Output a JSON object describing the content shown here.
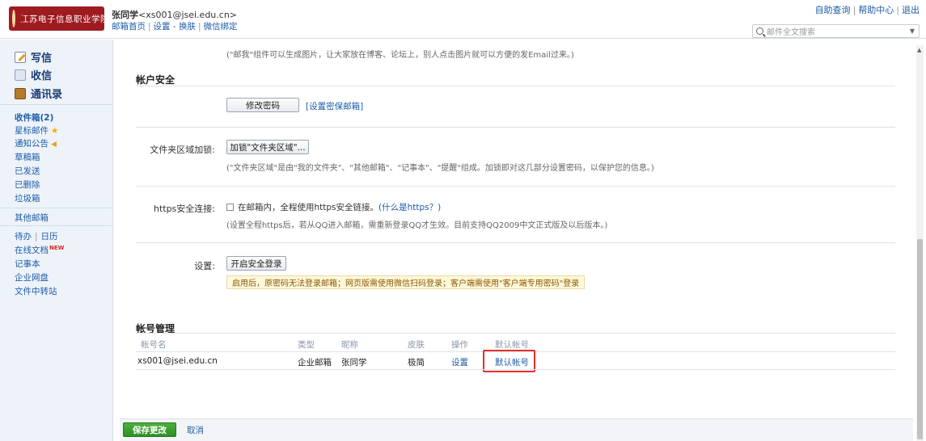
{
  "header": {
    "logo_text": "江苏电子信息职业学院",
    "user_name": "张同学",
    "user_email": "<xs001@jsei.edu.cn>",
    "links": [
      "邮箱首页",
      "设置",
      "换肤",
      "微信绑定"
    ],
    "top_links": [
      "自助查询",
      "帮助中心",
      "退出"
    ],
    "search_placeholder": "邮件全文搜索"
  },
  "sidebar": {
    "primary": [
      {
        "label": "写信",
        "icon": "pencil-icon"
      },
      {
        "label": "收信",
        "icon": "inbox-icon"
      },
      {
        "label": "通讯录",
        "icon": "contacts-icon"
      }
    ],
    "folders": [
      "收件箱(2)",
      "星标邮件",
      "通知公告",
      "草稿箱",
      "已发送",
      "已删除",
      "垃圾箱"
    ],
    "other": "其他邮箱",
    "tools": {
      "todo": "待办",
      "calendar": "日历",
      "online_docs": "在线文档",
      "new_badge": "NEW",
      "notes": "记事本",
      "netdisk": "企业网盘",
      "transfer": "文件中转站"
    }
  },
  "main": {
    "top_hint": "(\"邮我\"组件可以生成图片，让大家放在博客、论坛上，别人点击图片就可以方便的发Email过来。)",
    "security": {
      "title": "帐户安全",
      "change_password": "修改密码",
      "set_protect_email": "[设置密保邮箱]",
      "folder_lock_label": "文件夹区域加锁:",
      "folder_lock_button": "加锁\"文件夹区域\"...",
      "folder_lock_hint": "(\"文件夹区域\"是由\"我的文件夹\"、\"其他邮箱\"、\"记事本\"、\"提醒\"组成。加锁即对这几部分设置密码，以保护您的信息。)",
      "https_label": "https安全连接:",
      "https_checkbox": "在邮箱内，全程使用https安全链接。",
      "https_link": "(什么是https？)",
      "https_hint": "(设置全程https后，若从QQ进入邮箱，需重新登录QQ才生效。目前支持QQ2009中文正式版及以后版本。)",
      "setting_label": "设置:",
      "secure_login_button": "开启安全登录",
      "secure_login_warning": "启用后，原密码无法登录邮箱；网页版需使用微信扫码登录；客户端需使用\"客户端专用密码\"登录"
    },
    "accounts": {
      "title": "帐号管理",
      "headers": [
        "帐号名",
        "类型",
        "昵称",
        "皮肤",
        "操作",
        "默认帐号"
      ],
      "rows": [
        {
          "account": "xs001@jsei.edu.cn",
          "type": "企业邮箱",
          "nickname": "张同学",
          "skin": "极简",
          "action": "设置",
          "default": "默认帐号"
        }
      ]
    }
  },
  "footer": {
    "save": "保存更改",
    "cancel": "取消"
  }
}
